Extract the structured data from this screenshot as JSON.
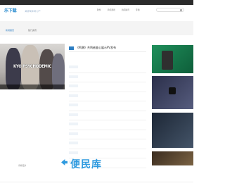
{
  "topbar": {
    "items": [
      "",
      "",
      "",
      "",
      "",
      ""
    ]
  },
  "logo": {
    "text": "乐下载",
    "slogan": "爱游戏手机门户"
  },
  "nav": {
    "items": [
      "软件",
      "手机游戏",
      "新闻资讯",
      "专题"
    ]
  },
  "subnav": {
    "items": [
      "新闻首页",
      "热门资讯"
    ]
  },
  "banner": {
    "title": "KYO PSYCHODEMIC",
    "caption": ""
  },
  "left_section": {
    "title": "",
    "more": "查看更多",
    "lines": [
      "",
      "",
      "",
      "",
      "",
      "",
      "",
      "",
      "",
      "",
      ""
    ]
  },
  "article": {
    "title": "《鸣潮》共鸣者鉴心展示PV发布"
  },
  "mid_list": [
    {
      "tag": "",
      "text": "",
      "date": ""
    },
    {
      "tag": "",
      "text": "",
      "date": ""
    },
    {
      "tag": "",
      "text": "",
      "date": ""
    },
    {
      "tag": "",
      "text": "",
      "date": ""
    },
    {
      "tag": "",
      "text": "",
      "date": ""
    },
    {
      "tag": "",
      "text": "",
      "date": ""
    },
    {
      "tag": "",
      "text": "",
      "date": ""
    },
    {
      "tag": "",
      "text": "",
      "date": ""
    },
    {
      "tag": "",
      "text": "",
      "date": ""
    },
    {
      "tag": "",
      "text": "",
      "date": ""
    },
    {
      "tag": "",
      "text": "",
      "date": ""
    },
    {
      "tag": "",
      "text": "",
      "date": ""
    }
  ],
  "thumbs": [
    {
      "caption": ""
    },
    {
      "caption": ""
    },
    {
      "caption": ""
    },
    {
      "caption": ""
    }
  ],
  "watermark": {
    "text": "便民库"
  },
  "footer": {
    "title": ""
  },
  "colors": {
    "accent": "#2d7ec3",
    "topbar": "#2b2b2b",
    "watermark": "#2e9adf"
  }
}
